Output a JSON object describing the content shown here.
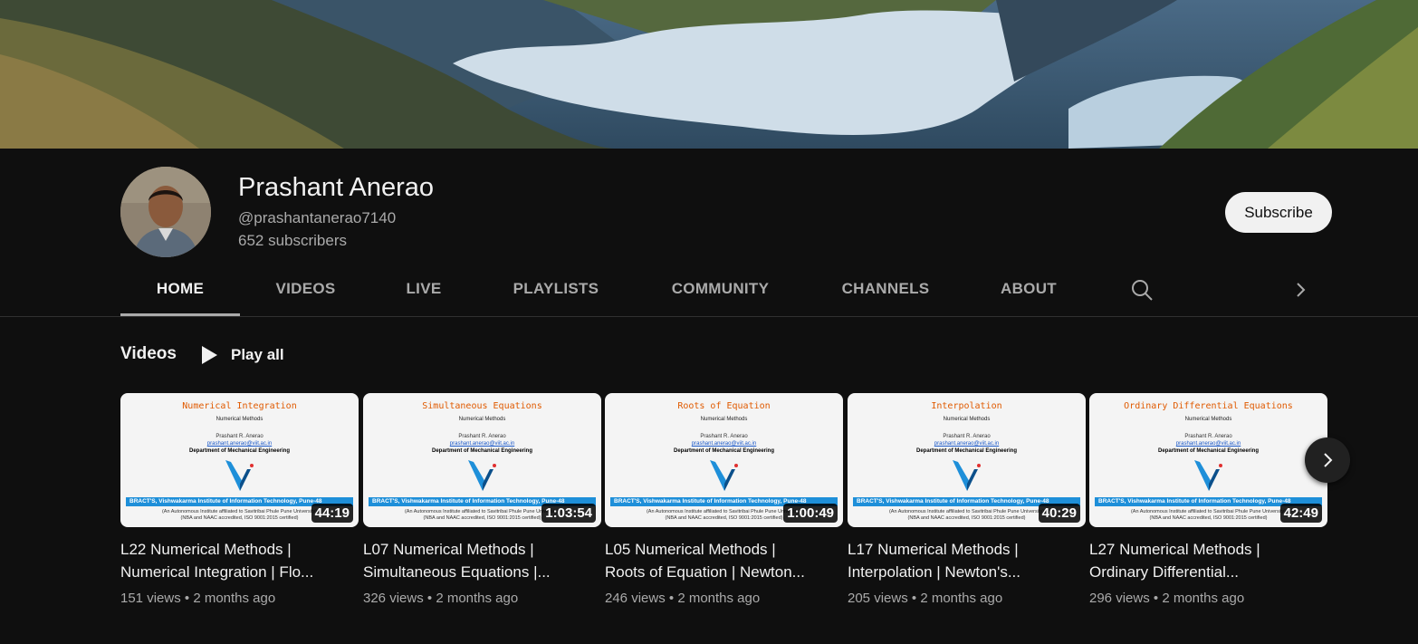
{
  "channel": {
    "name": "Prashant Anerao",
    "handle": "@prashantanerao7140",
    "subscribers": "652 subscribers",
    "subscribe_label": "Subscribe"
  },
  "tabs": [
    {
      "label": "HOME",
      "active": true
    },
    {
      "label": "VIDEOS",
      "active": false
    },
    {
      "label": "LIVE",
      "active": false
    },
    {
      "label": "PLAYLISTS",
      "active": false
    },
    {
      "label": "COMMUNITY",
      "active": false
    },
    {
      "label": "CHANNELS",
      "active": false
    },
    {
      "label": "ABOUT",
      "active": false
    }
  ],
  "shelf": {
    "title": "Videos",
    "play_all_label": "Play all"
  },
  "thumbnail_common": {
    "subtitle": "Numerical Methods",
    "author": "Prashant R. Anerao",
    "email": "prashant.anerao@viit.ac.in",
    "department": "Department of Mechanical Engineering",
    "bar_text": "BRACT'S, Vishwakarma Institute of Information Technology, Pune-48",
    "foot_line1": "(An Autonomous Institute affiliated to Savitribai Phule Pune University)",
    "foot_line2": "(NBA and NAAC accredited, ISO 9001:2015 certified)"
  },
  "videos": [
    {
      "thumb_title": "Numerical Integration",
      "duration": "44:19",
      "title_line1": "L22 Numerical Methods |",
      "title_line2": "Numerical Integration | Flo...",
      "views": "151 views",
      "age": "2 months ago"
    },
    {
      "thumb_title": "Simultaneous Equations",
      "duration": "1:03:54",
      "title_line1": "L07 Numerical Methods |",
      "title_line2": "Simultaneous Equations |...",
      "views": "326 views",
      "age": "2 months ago"
    },
    {
      "thumb_title": "Roots of Equation",
      "duration": "1:00:49",
      "title_line1": "L05 Numerical Methods |",
      "title_line2": "Roots of Equation | Newton...",
      "views": "246 views",
      "age": "2 months ago"
    },
    {
      "thumb_title": "Interpolation",
      "duration": "40:29",
      "title_line1": "L17 Numerical Methods |",
      "title_line2": "Interpolation | Newton's...",
      "views": "205 views",
      "age": "2 months ago"
    },
    {
      "thumb_title": "Ordinary Differential Equations",
      "duration": "42:49",
      "title_line1": "L27 Numerical Methods |",
      "title_line2": "Ordinary Differential...",
      "views": "296 views",
      "age": "2 months ago"
    }
  ],
  "meta_separator": "•",
  "icons": [
    "search-icon",
    "chevron-right-icon",
    "play-icon",
    "institute-logo-icon"
  ],
  "colors": {
    "background": "#0f0f0f",
    "accent_thumb_title": "#e05a00",
    "institute_bar": "#1e8fd9"
  }
}
